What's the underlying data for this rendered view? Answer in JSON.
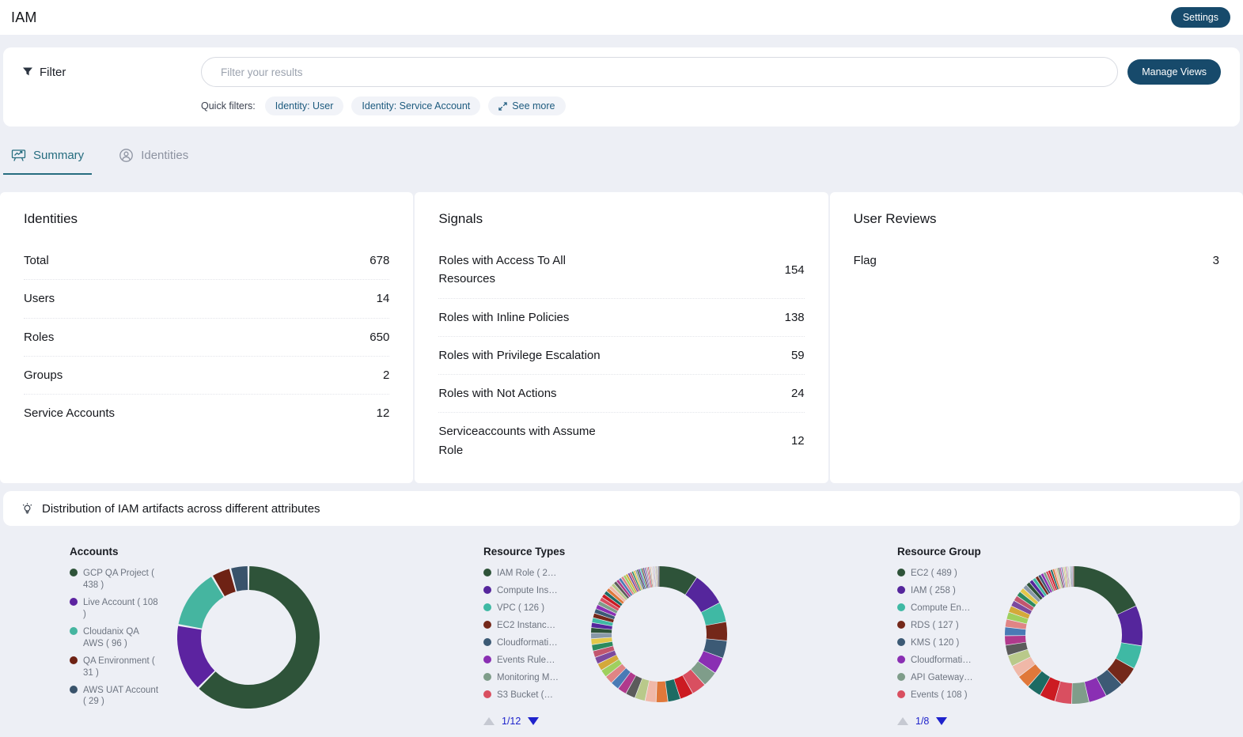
{
  "header": {
    "title": "IAM",
    "settings_button": "Settings"
  },
  "filter": {
    "label": "Filter",
    "placeholder": "Filter your results",
    "manage_views": "Manage Views",
    "quick_filters_label": "Quick filters:",
    "quick_filters": [
      "Identity: User",
      "Identity: Service Account"
    ],
    "see_more": "See more"
  },
  "tabs": [
    {
      "label": "Summary",
      "active": true
    },
    {
      "label": "Identities",
      "active": false
    }
  ],
  "cards": {
    "identities": {
      "title": "Identities",
      "rows": [
        {
          "label": "Total",
          "value": "678"
        },
        {
          "label": "Users",
          "value": "14"
        },
        {
          "label": "Roles",
          "value": "650"
        },
        {
          "label": "Groups",
          "value": "2"
        },
        {
          "label": "Service Accounts",
          "value": "12"
        }
      ]
    },
    "signals": {
      "title": "Signals",
      "rows": [
        {
          "label": "Roles with Access To All Resources",
          "value": "154"
        },
        {
          "label": "Roles with Inline Policies",
          "value": "138"
        },
        {
          "label": "Roles with Privilege Escalation",
          "value": "59"
        },
        {
          "label": "Roles with Not Actions",
          "value": "24"
        },
        {
          "label": "Serviceaccounts with Assume Role",
          "value": "12"
        }
      ]
    },
    "user_reviews": {
      "title": "User Reviews",
      "rows": [
        {
          "label": "Flag",
          "value": "3"
        }
      ]
    }
  },
  "distribution": {
    "title": "Distribution of IAM artifacts across different attributes"
  },
  "colors": {
    "navy": "#174a6b",
    "tab_active": "#266d7f",
    "pill_text": "#1c5a7e",
    "pagination_blue": "#1e22cc",
    "palette": [
      "#2e5339",
      "#55269c",
      "#3fb9a4",
      "#74281a",
      "#3c5a75",
      "#8a2fb3",
      "#7f9d8a",
      "#d94f60",
      "#cc1b22",
      "#1d6b63",
      "#e0783a",
      "#f0b8a8",
      "#b9c98a",
      "#5b5b5b",
      "#b03a8c",
      "#4a7ab5",
      "#e08585",
      "#9fd05e",
      "#d4a93a",
      "#7c4a9e",
      "#c2566e",
      "#2d8a5e",
      "#e3c84a",
      "#8898a8"
    ]
  },
  "chart_data": [
    {
      "type": "pie",
      "title": "Accounts",
      "legend": [
        "GCP QA Project ( 438 )",
        "Live Account ( 108 )",
        "Cloudanix QA AWS ( 96 )",
        "QA Environment ( 31 )",
        "AWS UAT Account ( 29 )"
      ],
      "labels": [
        "GCP QA Project",
        "Live Account",
        "Cloudanix QA AWS",
        "QA Environment",
        "AWS UAT Account"
      ],
      "values": [
        438,
        108,
        96,
        31,
        29
      ],
      "colors": [
        "#2e5339",
        "#5c23a0",
        "#45b5a0",
        "#6e2214",
        "#39536b"
      ],
      "legend_position": "left",
      "pagination": null
    },
    {
      "type": "pie",
      "title": "Resource Types",
      "legend": [
        "IAM Role ( 2…",
        "Compute Ins…",
        "VPC ( 126 )",
        "EC2 Instanc…",
        "Cloudformati…",
        "Events Rule…",
        "Monitoring M…",
        "S3 Bucket (…"
      ],
      "legend_known_values": {
        "VPC": 126
      },
      "values": [
        250,
        215,
        126,
        120,
        112,
        105,
        98,
        92,
        85,
        80,
        75,
        70,
        66,
        62,
        58,
        55,
        52,
        49,
        46,
        44,
        42,
        40,
        38,
        36,
        34,
        32,
        31,
        30,
        29,
        28,
        27,
        26,
        25,
        24,
        23,
        22,
        21,
        20,
        19,
        18,
        17,
        16,
        15,
        14,
        13,
        12,
        12,
        11,
        11,
        10,
        10,
        9,
        9,
        8,
        8,
        7,
        7,
        6,
        6,
        5,
        5,
        5,
        4,
        4,
        4,
        3,
        3,
        3,
        2,
        2,
        2,
        2,
        1,
        1,
        1,
        1,
        1,
        1,
        1,
        1
      ],
      "legend_position": "left",
      "pagination": "1/12"
    },
    {
      "type": "pie",
      "title": "Resource Group",
      "legend": [
        "EC2 ( 489 )",
        "IAM ( 258 )",
        "Compute En…",
        "RDS ( 127 )",
        "KMS ( 120 )",
        "Cloudformati…",
        "API Gateway…",
        "Events ( 108 )"
      ],
      "legend_known_values": {
        "EC2": 489,
        "IAM": 258,
        "RDS": 127,
        "KMS": 120,
        "Events": 108
      },
      "values": [
        489,
        258,
        150,
        127,
        120,
        115,
        110,
        108,
        100,
        92,
        85,
        78,
        72,
        66,
        60,
        55,
        50,
        46,
        42,
        38,
        35,
        32,
        30,
        28,
        26,
        24,
        22,
        20,
        19,
        18,
        17,
        16,
        15,
        14,
        13,
        12,
        11,
        10,
        9,
        8,
        8,
        7,
        7,
        6,
        6,
        5,
        5,
        4,
        4,
        3,
        3,
        3,
        2,
        2,
        2,
        2,
        1,
        1,
        1,
        1
      ],
      "legend_position": "left",
      "pagination": "1/8"
    }
  ]
}
